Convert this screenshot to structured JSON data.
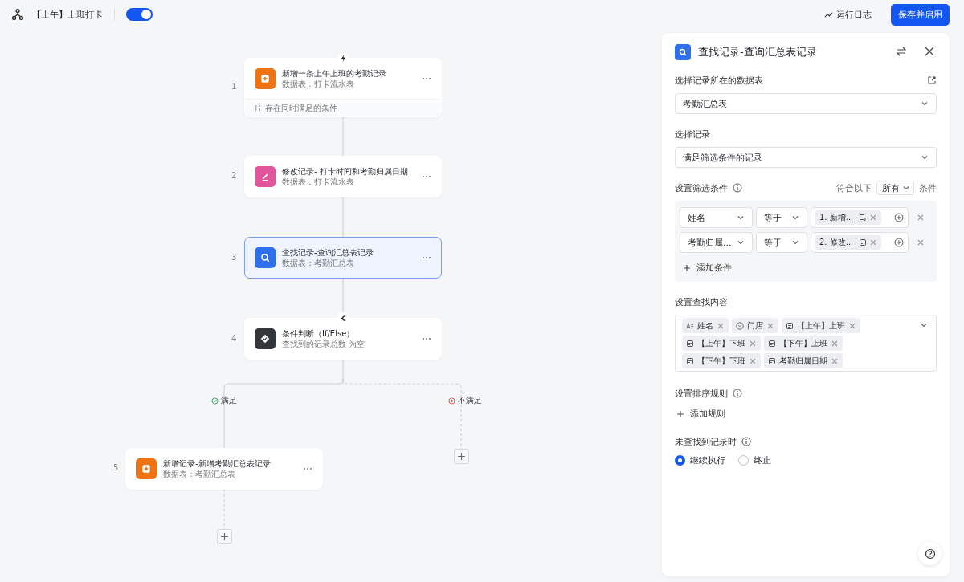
{
  "header": {
    "title": "【上午】上班打卡",
    "enabled": true,
    "run_log": "运行日志",
    "save": "保存并启用"
  },
  "nodes": [
    {
      "number": "1",
      "kind": "add",
      "title": "新增一条上午上班的考勤记录",
      "subtitle": "数据表：打卡流水表",
      "footer": "存在同时满足的条件",
      "selected": false
    },
    {
      "number": "2",
      "kind": "edit",
      "title": "修改记录- 打卡时间和考勤归属日期",
      "subtitle": "数据表：打卡流水表",
      "selected": false
    },
    {
      "number": "3",
      "kind": "search",
      "title": "查找记录-查询汇总表记录",
      "subtitle": "数据表：考勤汇总表",
      "selected": true
    },
    {
      "number": "4",
      "kind": "condition",
      "title": "条件判断（If/Else）",
      "subtitle": "查找到的记录总数 为空",
      "selected": false
    },
    {
      "number": "5",
      "kind": "add",
      "title": "新增记录-新增考勤汇总表记录",
      "subtitle": "数据表：考勤汇总表",
      "selected": false
    }
  ],
  "branches": [
    {
      "kind": "yes",
      "label": "满足"
    },
    {
      "kind": "no",
      "label": "不满足"
    }
  ],
  "panel": {
    "title": "查找记录-查询汇总表记录",
    "table_label": "选择记录所在的数据表",
    "table_value": "考勤汇总表",
    "record_label": "选择记录",
    "record_value": "满足筛选条件的记录",
    "filter_label": "设置筛选条件",
    "match_prefix": "符合以下",
    "match_value": "所有",
    "match_suffix": "条件",
    "conditions": [
      {
        "field": "姓名",
        "op": "等于",
        "value": "1. 新增...",
        "kind": "text"
      },
      {
        "field": "考勤归属...",
        "op": "等于",
        "value": "2. 修改...",
        "kind": "date"
      }
    ],
    "add_condition": "添加条件",
    "fields_label": "设置查找内容",
    "fields": [
      {
        "kind": "text",
        "label": "姓名"
      },
      {
        "kind": "select",
        "label": "门店"
      },
      {
        "kind": "date",
        "label": "【上午】上班"
      },
      {
        "kind": "date",
        "label": "【上午】下班"
      },
      {
        "kind": "date",
        "label": "【下午】上班"
      },
      {
        "kind": "date",
        "label": "【下午】下班"
      },
      {
        "kind": "date",
        "label": "考勤归属日期"
      }
    ],
    "sort_label": "设置排序规则",
    "add_rule": "添加规则",
    "notfound_label": "未查找到记录时",
    "notfound_options": [
      {
        "label": "继续执行",
        "selected": true
      },
      {
        "label": "终止",
        "selected": false
      }
    ]
  }
}
